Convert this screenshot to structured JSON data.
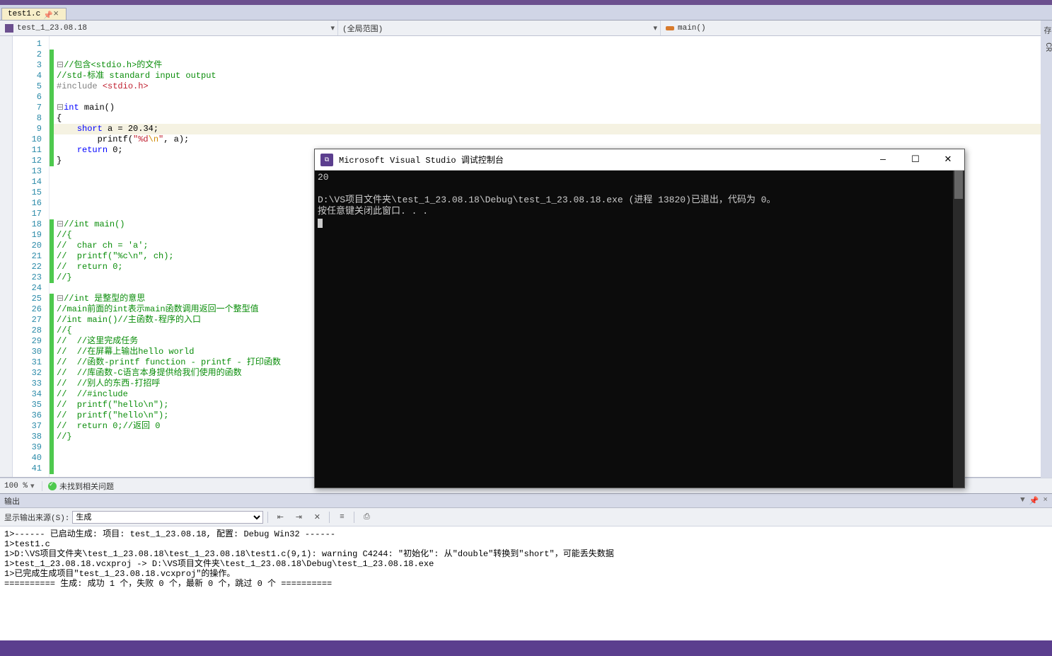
{
  "tab": {
    "name": "test1.c"
  },
  "nav": {
    "project": "test_1_23.08.18",
    "scope": "(全局范围)",
    "member": "main()"
  },
  "code": {
    "lines": [
      {
        "n": 1,
        "raw": "",
        "cb": false
      },
      {
        "n": 2,
        "raw": "",
        "cb": true
      },
      {
        "n": 3,
        "raw": "box-//包含<stdio.h>的文件",
        "cb": true,
        "type": "comment",
        "box": true
      },
      {
        "n": 4,
        "raw": "//std-标准 standard input output",
        "cb": true,
        "type": "comment"
      },
      {
        "n": 5,
        "raw": "#include <stdio.h>",
        "cb": true,
        "type": "include"
      },
      {
        "n": 6,
        "raw": "",
        "cb": true
      },
      {
        "n": 7,
        "raw": "int main()",
        "cb": true,
        "type": "intmain",
        "box": true
      },
      {
        "n": 8,
        "raw": "{",
        "cb": true
      },
      {
        "n": 9,
        "raw": "    short a = 20.34;",
        "cb": true,
        "type": "short",
        "hl": true
      },
      {
        "n": 10,
        "raw": "        printf(\"%d\\n\", a);",
        "cb": true,
        "type": "printf"
      },
      {
        "n": 11,
        "raw": "    return 0;",
        "cb": true,
        "type": "return"
      },
      {
        "n": 12,
        "raw": "}",
        "cb": true
      },
      {
        "n": 13,
        "raw": "",
        "cb": false
      },
      {
        "n": 14,
        "raw": "",
        "cb": false
      },
      {
        "n": 15,
        "raw": "",
        "cb": false
      },
      {
        "n": 16,
        "raw": "",
        "cb": false
      },
      {
        "n": 17,
        "raw": "",
        "cb": false
      },
      {
        "n": 18,
        "raw": "//int main()",
        "cb": true,
        "type": "comment",
        "box": true
      },
      {
        "n": 19,
        "raw": "//{",
        "cb": true,
        "type": "comment"
      },
      {
        "n": 20,
        "raw": "//  char ch = 'a';",
        "cb": true,
        "type": "comment"
      },
      {
        "n": 21,
        "raw": "//  printf(\"%c\\n\", ch);",
        "cb": true,
        "type": "comment"
      },
      {
        "n": 22,
        "raw": "//  return 0;",
        "cb": true,
        "type": "comment"
      },
      {
        "n": 23,
        "raw": "//}",
        "cb": true,
        "type": "comment"
      },
      {
        "n": 24,
        "raw": "",
        "cb": false
      },
      {
        "n": 25,
        "raw": "//int 是整型的意思",
        "cb": true,
        "type": "comment",
        "box": true
      },
      {
        "n": 26,
        "raw": "//main前面的int表示main函数调用返回一个整型值",
        "cb": true,
        "type": "comment"
      },
      {
        "n": 27,
        "raw": "//int main()//主函数-程序的入口",
        "cb": true,
        "type": "comment"
      },
      {
        "n": 28,
        "raw": "//{",
        "cb": true,
        "type": "comment"
      },
      {
        "n": 29,
        "raw": "//  //这里完成任务",
        "cb": true,
        "type": "comment"
      },
      {
        "n": 30,
        "raw": "//  //在屏幕上输出hello world",
        "cb": true,
        "type": "comment"
      },
      {
        "n": 31,
        "raw": "//  //函数-printf function - printf - 打印函数",
        "cb": true,
        "type": "comment"
      },
      {
        "n": 32,
        "raw": "//  //库函数-C语言本身提供给我们使用的函数",
        "cb": true,
        "type": "comment"
      },
      {
        "n": 33,
        "raw": "//  //别人的东西-打招呼",
        "cb": true,
        "type": "comment"
      },
      {
        "n": 34,
        "raw": "//  //#include",
        "cb": true,
        "type": "comment"
      },
      {
        "n": 35,
        "raw": "//  printf(\"hello\\n\");",
        "cb": true,
        "type": "comment"
      },
      {
        "n": 36,
        "raw": "//  printf(\"hello\\n\");",
        "cb": true,
        "type": "comment"
      },
      {
        "n": 37,
        "raw": "//  return 0;//返回 0",
        "cb": true,
        "type": "comment"
      },
      {
        "n": 38,
        "raw": "//}",
        "cb": true,
        "type": "comment"
      },
      {
        "n": 39,
        "raw": "",
        "cb": true
      },
      {
        "n": 40,
        "raw": "",
        "cb": true
      },
      {
        "n": 41,
        "raw": "",
        "cb": true
      }
    ]
  },
  "footer": {
    "zoom": "100 %",
    "issues": "未找到相关问题"
  },
  "output": {
    "title": "输出",
    "source_label": "显示输出来源(S):",
    "source_value": "生成",
    "lines": [
      "1>------ 已启动生成: 项目: test_1_23.08.18, 配置: Debug Win32 ------",
      "1>test1.c",
      "1>D:\\VS项目文件夹\\test_1_23.08.18\\test_1_23.08.18\\test1.c(9,1): warning C4244: \"初始化\": 从\"double\"转换到\"short\"，可能丢失数据",
      "1>test_1_23.08.18.vcxproj -> D:\\VS项目文件夹\\test_1_23.08.18\\Debug\\test_1_23.08.18.exe",
      "1>已完成生成项目\"test_1_23.08.18.vcxproj\"的操作。",
      "========== 生成: 成功 1 个，失败 0 个，最新 0 个，跳过 0 个 =========="
    ]
  },
  "console": {
    "title": "Microsoft Visual Studio 调试控制台",
    "lines": [
      "20",
      "",
      "D:\\VS项目文件夹\\test_1_23.08.18\\Debug\\test_1_23.08.18.exe (进程 13820)已退出，代码为 0。",
      "按任意键关闭此窗口. . ."
    ]
  },
  "right": {
    "a": "存",
    "b": "CR"
  }
}
